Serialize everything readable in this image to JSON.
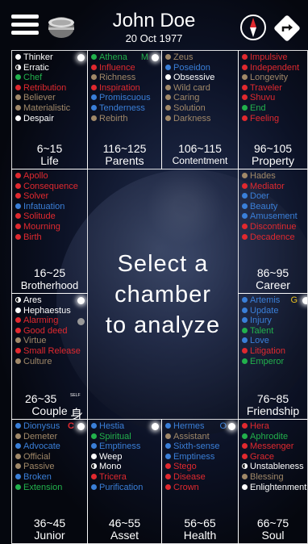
{
  "header": {
    "name": "John Doe",
    "date": "20 Oct 1977"
  },
  "center": {
    "lines": [
      "Select a",
      "chamber",
      "to analyze"
    ]
  },
  "colors": {
    "white": "#ffffff",
    "halfwhite": "#ffffff",
    "green": "#22b14c",
    "gray": "#a08868",
    "red": "#e0292f",
    "blue": "#3a7fd8",
    "halfblue": "#3a7fd8"
  },
  "chambers": {
    "life": {
      "age": "6~15",
      "label": "Life",
      "items": [
        {
          "t": "Thinker",
          "c": "white"
        },
        {
          "t": "Erratic",
          "c": "halfwhite"
        },
        {
          "t": "Chef",
          "c": "green"
        },
        {
          "t": "Retribution",
          "c": "red"
        },
        {
          "t": "Believer",
          "c": "gray"
        },
        {
          "t": "Materialistic",
          "c": "gray"
        },
        {
          "t": "Despair",
          "c": "white"
        }
      ]
    },
    "parents": {
      "age": "116~125",
      "label": "Parents",
      "marker": "M",
      "items": [
        {
          "t": "Athena",
          "c": "green"
        },
        {
          "t": "Influence",
          "c": "red"
        },
        {
          "t": "Richness",
          "c": "gray"
        },
        {
          "t": "Inspiration",
          "c": "red"
        },
        {
          "t": "Promiscuous",
          "c": "blue"
        },
        {
          "t": "Tenderness",
          "c": "blue"
        },
        {
          "t": "Rebirth",
          "c": "gray"
        }
      ]
    },
    "contentment": {
      "age": "106~115",
      "label": "Contentment",
      "items": [
        {
          "t": "Zeus",
          "c": "gray"
        },
        {
          "t": "Poseidon",
          "c": "blue"
        },
        {
          "t": "Obsessive",
          "c": "white"
        },
        {
          "t": "Wild card",
          "c": "gray"
        },
        {
          "t": "Caring",
          "c": "gray"
        },
        {
          "t": "Solution",
          "c": "gray"
        },
        {
          "t": "Darkness",
          "c": "gray"
        }
      ]
    },
    "property": {
      "age": "96~105",
      "label": "Property",
      "items": [
        {
          "t": "Impulsive",
          "c": "red"
        },
        {
          "t": "Independent",
          "c": "red"
        },
        {
          "t": "Longevity",
          "c": "gray"
        },
        {
          "t": "Traveler",
          "c": "red"
        },
        {
          "t": "Shuvu",
          "c": "red"
        },
        {
          "t": "End",
          "c": "green"
        },
        {
          "t": "Feeling",
          "c": "red"
        }
      ]
    },
    "brotherhood": {
      "age": "16~25",
      "label": "Brotherhood",
      "items": [
        {
          "t": "Apollo",
          "c": "red"
        },
        {
          "t": "Consequence",
          "c": "red"
        },
        {
          "t": "Solver",
          "c": "red"
        },
        {
          "t": "Infatuation",
          "c": "blue"
        },
        {
          "t": "Solitude",
          "c": "red"
        },
        {
          "t": "Mourning",
          "c": "red"
        },
        {
          "t": "Birth",
          "c": "red"
        }
      ]
    },
    "career": {
      "age": "86~95",
      "label": "Career",
      "items": [
        {
          "t": "Hades",
          "c": "gray"
        },
        {
          "t": "Mediator",
          "c": "red"
        },
        {
          "t": "Doer",
          "c": "blue"
        },
        {
          "t": "Beauty",
          "c": "blue"
        },
        {
          "t": "Amusement",
          "c": "blue"
        },
        {
          "t": "Discontinue",
          "c": "red"
        },
        {
          "t": "Decadence",
          "c": "red"
        }
      ]
    },
    "couple": {
      "age": "26~35",
      "label": "Couple",
      "self_glyph": "身",
      "self_small": "SELF",
      "items": [
        {
          "t": "Ares",
          "c": "halfwhite"
        },
        {
          "t": "Hephaestus",
          "c": "white"
        },
        {
          "t": "Alarming",
          "c": "red"
        },
        {
          "t": "Good deed",
          "c": "red"
        },
        {
          "t": "Virtue",
          "c": "gray"
        },
        {
          "t": "Small Release",
          "c": "red"
        },
        {
          "t": "Culture",
          "c": "gray"
        }
      ]
    },
    "friendship": {
      "age": "76~85",
      "label": "Friendship",
      "marker": "G",
      "items": [
        {
          "t": "Artemis",
          "c": "blue"
        },
        {
          "t": "Update",
          "c": "blue"
        },
        {
          "t": "Injury",
          "c": "blue"
        },
        {
          "t": "Talent",
          "c": "green"
        },
        {
          "t": "Love",
          "c": "blue"
        },
        {
          "t": "Litigation",
          "c": "red"
        },
        {
          "t": "Emperor",
          "c": "green"
        }
      ]
    },
    "junior": {
      "age": "36~45",
      "label": "Junior",
      "marker": "C",
      "items": [
        {
          "t": "Dionysus",
          "c": "blue"
        },
        {
          "t": "Demeter",
          "c": "gray"
        },
        {
          "t": "Advocate",
          "c": "blue"
        },
        {
          "t": "Official",
          "c": "gray"
        },
        {
          "t": "Passive",
          "c": "gray"
        },
        {
          "t": "Broken",
          "c": "blue"
        },
        {
          "t": "Extension",
          "c": "green"
        }
      ]
    },
    "asset": {
      "age": "46~55",
      "label": "Asset",
      "items": [
        {
          "t": "Hestia",
          "c": "blue"
        },
        {
          "t": "Spiritual",
          "c": "green"
        },
        {
          "t": "Emptiness",
          "c": "blue"
        },
        {
          "t": "Weep",
          "c": "white"
        },
        {
          "t": "Mono",
          "c": "halfwhite"
        },
        {
          "t": "Tricera",
          "c": "red"
        },
        {
          "t": "Purification",
          "c": "blue"
        }
      ]
    },
    "health": {
      "age": "56~65",
      "label": "Health",
      "marker": "O",
      "items": [
        {
          "t": "Hermes",
          "c": "blue"
        },
        {
          "t": "Assistant",
          "c": "gray"
        },
        {
          "t": "Sixth-sense",
          "c": "blue"
        },
        {
          "t": "Emptiness",
          "c": "blue"
        },
        {
          "t": "Stego",
          "c": "red"
        },
        {
          "t": "Disease",
          "c": "red"
        },
        {
          "t": "Crown",
          "c": "red"
        }
      ]
    },
    "soul": {
      "age": "66~75",
      "label": "Soul",
      "items": [
        {
          "t": "Hera",
          "c": "red"
        },
        {
          "t": "Aphrodite",
          "c": "green"
        },
        {
          "t": "Messenger",
          "c": "red"
        },
        {
          "t": "Grace",
          "c": "red"
        },
        {
          "t": "Unstableness",
          "c": "halfwhite"
        },
        {
          "t": "Blessing",
          "c": "gray"
        },
        {
          "t": "Enlightenment",
          "c": "white"
        }
      ]
    }
  }
}
